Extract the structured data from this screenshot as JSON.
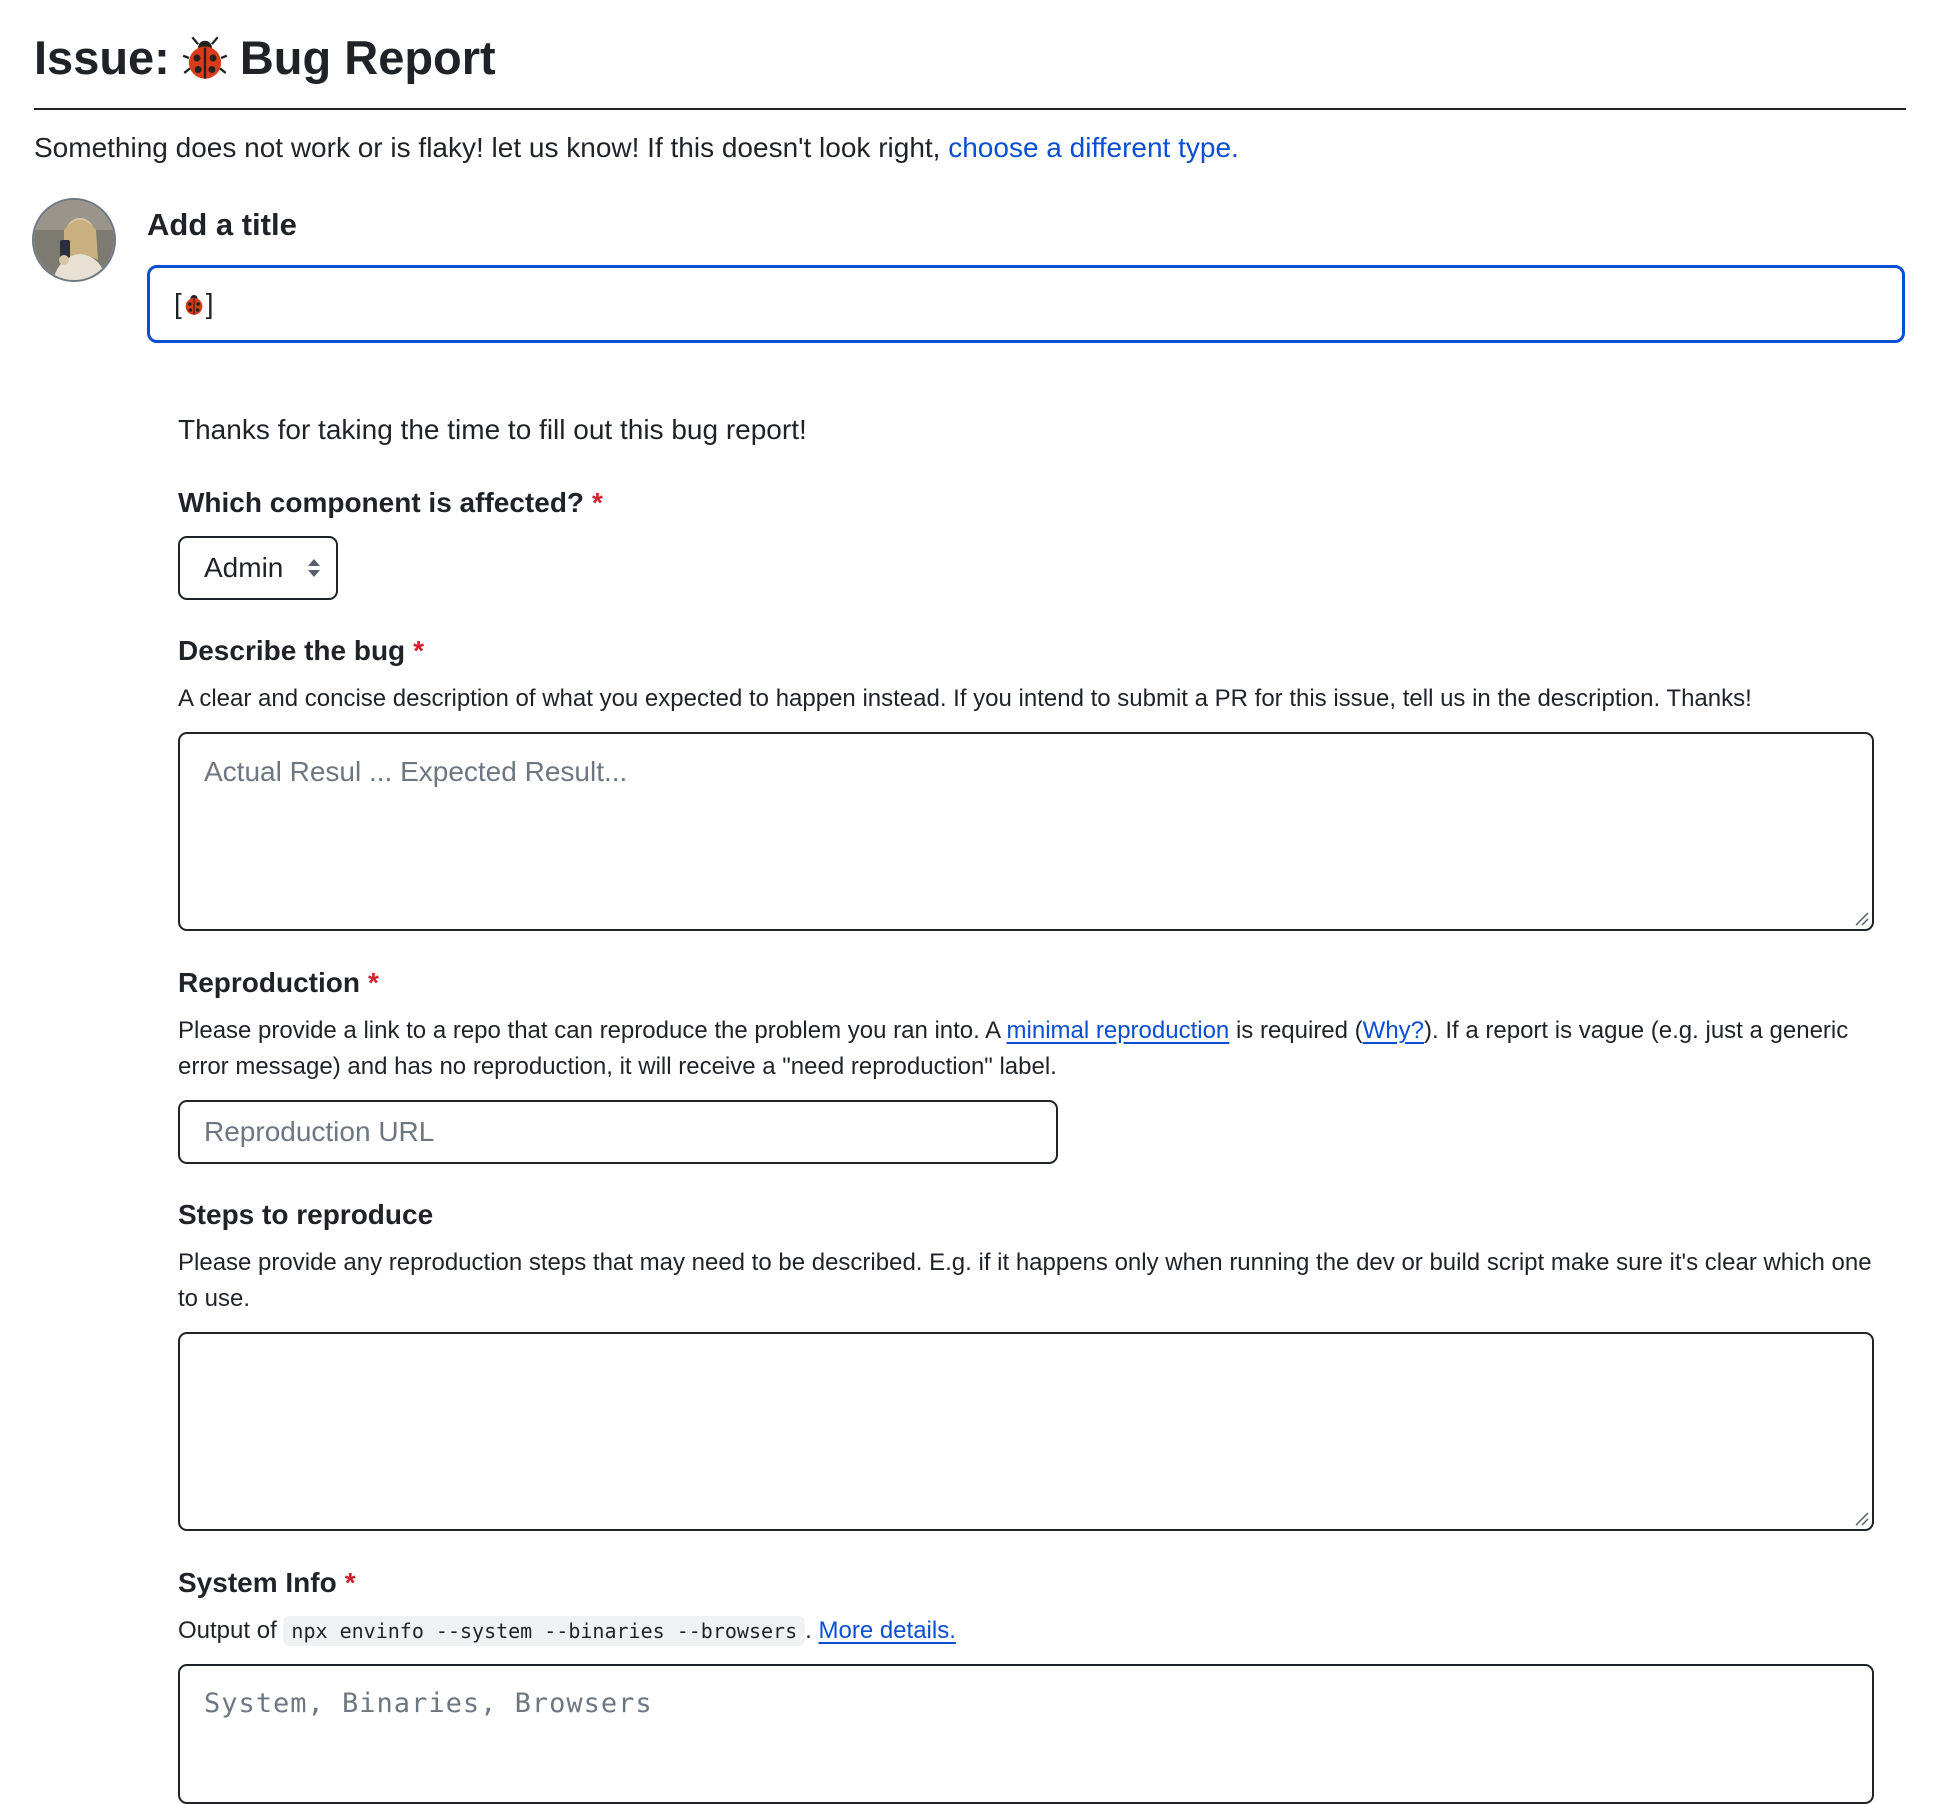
{
  "header": {
    "prefix": "Issue:",
    "icon": "ladybug-icon",
    "title": "Bug Report"
  },
  "intro": {
    "text": "Something does not work or is flaky! let us know! If this doesn't look right, ",
    "link": "choose a different type."
  },
  "title_field": {
    "label": "Add a title",
    "value_prefix": "[",
    "value_icon": "ladybug-icon",
    "value_suffix": "]"
  },
  "form": {
    "thanks": "Thanks for taking the time to fill out this bug report!",
    "required_mark": "*",
    "component": {
      "label": "Which component is affected?",
      "selected": "Admin"
    },
    "describe": {
      "label": "Describe the bug",
      "description": "A clear and concise description of what you expected to happen instead. If you intend to submit a PR for this issue, tell us in the description. Thanks!",
      "placeholder": "Actual Resul ... Expected Result..."
    },
    "reproduction": {
      "label": "Reproduction",
      "desc_before": "Please provide a link to a repo that can reproduce the problem you ran into. A ",
      "desc_link": "minimal reproduction",
      "desc_mid": " is required (",
      "desc_why": "Why?",
      "desc_after": "). If a report is vague (e.g. just a generic error message) and has no reproduction, it will receive a \"need reproduction\" label.",
      "placeholder": "Reproduction URL"
    },
    "steps": {
      "label": "Steps to reproduce",
      "description": "Please provide any reproduction steps that may need to be described. E.g. if it happens only when running the dev or build script make sure it's clear which one to use."
    },
    "system_info": {
      "label": "System Info",
      "desc_before": "Output of ",
      "command": "npx envinfo --system --binaries --browsers",
      "desc_mid": ". ",
      "desc_link": "More details.",
      "placeholder": "System, Binaries, Browsers"
    }
  },
  "colors": {
    "link": "#0a4fd1",
    "focus_border": "#0a4fd1",
    "required": "#cf222e",
    "placeholder": "#6e7781"
  }
}
